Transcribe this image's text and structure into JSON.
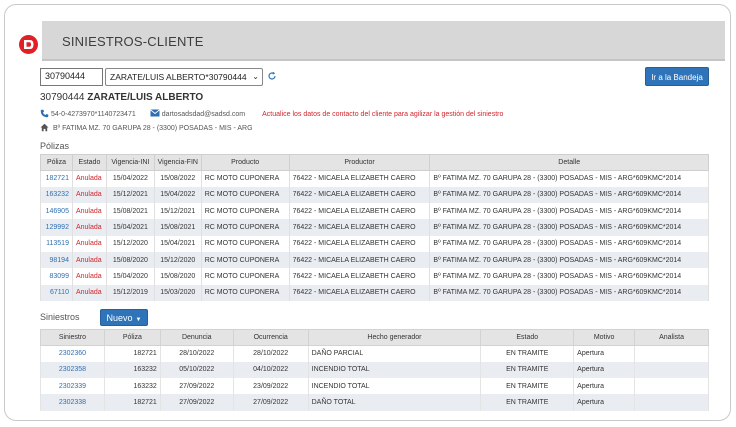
{
  "header": {
    "title": "SINIESTROS-CLIENTE"
  },
  "search": {
    "client_id_value": "30790444",
    "client_select_value": "ZARATE/LUIS ALBERTO*30790444"
  },
  "bandeja_button": "Ir a la Bandeja",
  "client": {
    "id": "30790444",
    "name": "ZARATE/LUIS ALBERTO",
    "phones": "54-0-4273970*1140723471",
    "email": "dartosadsdad@sadsd.com",
    "contact_warning": "Actualice los datos de contacto del cliente para agilizar la gestión del siniestro",
    "address": "Bº FATIMA MZ. 70 GARUPA 28 - (3300) POSADAS - MIS - ARG"
  },
  "polizas": {
    "label": "Pólizas",
    "columns": [
      "Póliza",
      "Estado",
      "Vigencia-INI",
      "Vigencia-FIN",
      "Producto",
      "Productor",
      "Detalle"
    ],
    "rows": [
      [
        "182721",
        "Anulada",
        "15/04/2022",
        "15/08/2022",
        "RC MOTO CUPONERA",
        "76422 - MICAELA ELIZABETH CAERO",
        "Bº FATIMA MZ. 70 GARUPA 28 - (3300) POSADAS - MIS - ARG*609KMC*2014"
      ],
      [
        "163232",
        "Anulada",
        "15/12/2021",
        "15/04/2022",
        "RC MOTO CUPONERA",
        "76422 - MICAELA ELIZABETH CAERO",
        "Bº FATIMA MZ. 70 GARUPA 28 - (3300) POSADAS - MIS - ARG*609KMC*2014"
      ],
      [
        "146905",
        "Anulada",
        "15/08/2021",
        "15/12/2021",
        "RC MOTO CUPONERA",
        "76422 - MICAELA ELIZABETH CAERO",
        "Bº FATIMA MZ. 70 GARUPA 28 - (3300) POSADAS - MIS - ARG*609KMC*2014"
      ],
      [
        "129992",
        "Anulada",
        "15/04/2021",
        "15/08/2021",
        "RC MOTO CUPONERA",
        "76422 - MICAELA ELIZABETH CAERO",
        "Bº FATIMA MZ. 70 GARUPA 28 - (3300) POSADAS - MIS - ARG*609KMC*2014"
      ],
      [
        "113519",
        "Anulada",
        "15/12/2020",
        "15/04/2021",
        "RC MOTO CUPONERA",
        "76422 - MICAELA ELIZABETH CAERO",
        "Bº FATIMA MZ. 70 GARUPA 28 - (3300) POSADAS - MIS - ARG*609KMC*2014"
      ],
      [
        "98194",
        "Anulada",
        "15/08/2020",
        "15/12/2020",
        "RC MOTO CUPONERA",
        "76422 - MICAELA ELIZABETH CAERO",
        "Bº FATIMA MZ. 70 GARUPA 28 - (3300) POSADAS - MIS - ARG*609KMC*2014"
      ],
      [
        "83099",
        "Anulada",
        "15/04/2020",
        "15/08/2020",
        "RC MOTO CUPONERA",
        "76422 - MICAELA ELIZABETH CAERO",
        "Bº FATIMA MZ. 70 GARUPA 28 - (3300) POSADAS - MIS - ARG*609KMC*2014"
      ],
      [
        "67110",
        "Anulada",
        "15/12/2019",
        "15/03/2020",
        "RC MOTO CUPONERA",
        "76422 - MICAELA ELIZABETH CAERO",
        "Bº FATIMA MZ. 70 GARUPA 28 - (3300) POSADAS - MIS - ARG*609KMC*2014"
      ]
    ]
  },
  "siniestros": {
    "label": "Siniestros",
    "new_button": "Nuevo",
    "columns": [
      "Siniestro",
      "Póliza",
      "Denuncia",
      "Ocurrencia",
      "Hecho generador",
      "Estado",
      "Motivo",
      "Analista"
    ],
    "rows": [
      [
        "2302360",
        "182721",
        "28/10/2022",
        "28/10/2022",
        "DAÑO PARCIAL",
        "EN TRAMITE",
        "Apertura",
        ""
      ],
      [
        "2302358",
        "163232",
        "05/10/2022",
        "04/10/2022",
        "INCENDIO TOTAL",
        "EN TRAMITE",
        "Apertura",
        ""
      ],
      [
        "2302339",
        "163232",
        "27/09/2022",
        "23/09/2022",
        "INCENDIO TOTAL",
        "EN TRAMITE",
        "Apertura",
        ""
      ],
      [
        "2302338",
        "182721",
        "27/09/2022",
        "27/09/2022",
        "DAÑO TOTAL",
        "EN TRAMITE",
        "Apertura",
        ""
      ]
    ]
  },
  "colors": {
    "brand_red": "#e01f26",
    "button_blue": "#2f74b9",
    "link_blue": "#2f6fb0",
    "status_red": "#d0262c"
  },
  "icons": [
    "app-logo",
    "refresh-icon",
    "phone-icon",
    "mail-icon",
    "home-icon",
    "caret-down-icon"
  ]
}
